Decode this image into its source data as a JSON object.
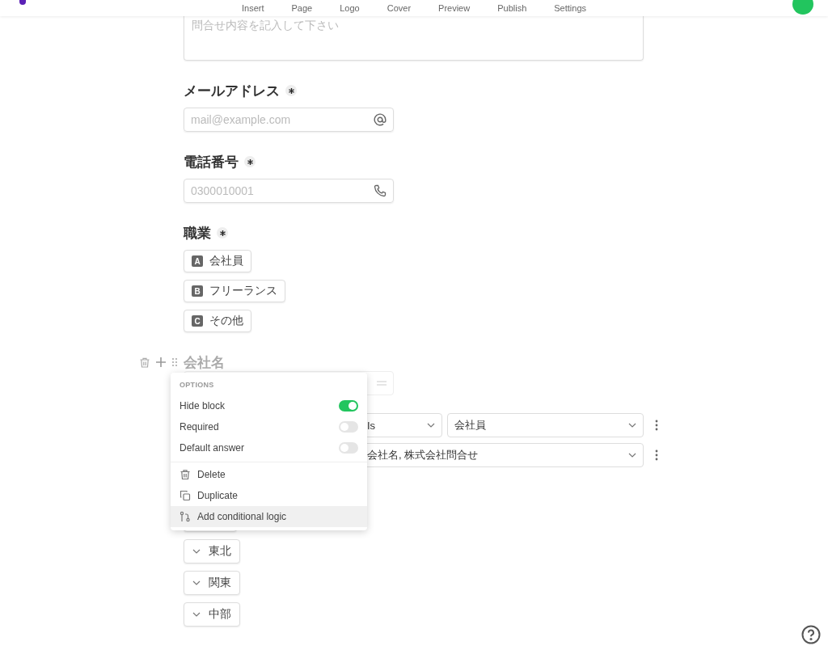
{
  "nav": {
    "items": [
      {
        "label": "Insert"
      },
      {
        "label": "Page"
      },
      {
        "label": "Logo"
      },
      {
        "label": "Cover"
      },
      {
        "label": "Preview"
      },
      {
        "label": "Publish"
      },
      {
        "label": "Settings"
      }
    ]
  },
  "inquiry": {
    "placeholder": "問合せ内容を記入して下さい"
  },
  "fields": [
    {
      "kind": "email",
      "label": "メールアドレス",
      "required": true,
      "placeholder": "mail@example.com"
    },
    {
      "kind": "phone",
      "label": "電話番号",
      "required": true,
      "placeholder": "0300010001"
    },
    {
      "kind": "choice",
      "label": "職業",
      "required": true,
      "choices": [
        {
          "key": "A",
          "label": "会社員"
        },
        {
          "key": "B",
          "label": "フリーランス"
        },
        {
          "key": "C",
          "label": "その他"
        }
      ]
    }
  ],
  "hidden_block": {
    "label": "会社名",
    "conditions": [
      {
        "operator": "Is",
        "value": "会社員"
      },
      {
        "value": "会社名, 株式会社問合せ"
      }
    ]
  },
  "options_menu": {
    "title": "OPTIONS",
    "toggles": [
      {
        "label": "Hide block",
        "on": true
      },
      {
        "label": "Required",
        "on": false
      },
      {
        "label": "Default answer",
        "on": false
      }
    ],
    "actions": [
      {
        "kind": "delete",
        "label": "Delete",
        "selected": false
      },
      {
        "kind": "duplicate",
        "label": "Duplicate",
        "selected": false
      },
      {
        "kind": "logic",
        "label": "Add conditional logic",
        "selected": true
      }
    ]
  },
  "regions": [
    {
      "label": "東北"
    },
    {
      "label": "関東"
    },
    {
      "label": "中部"
    }
  ]
}
